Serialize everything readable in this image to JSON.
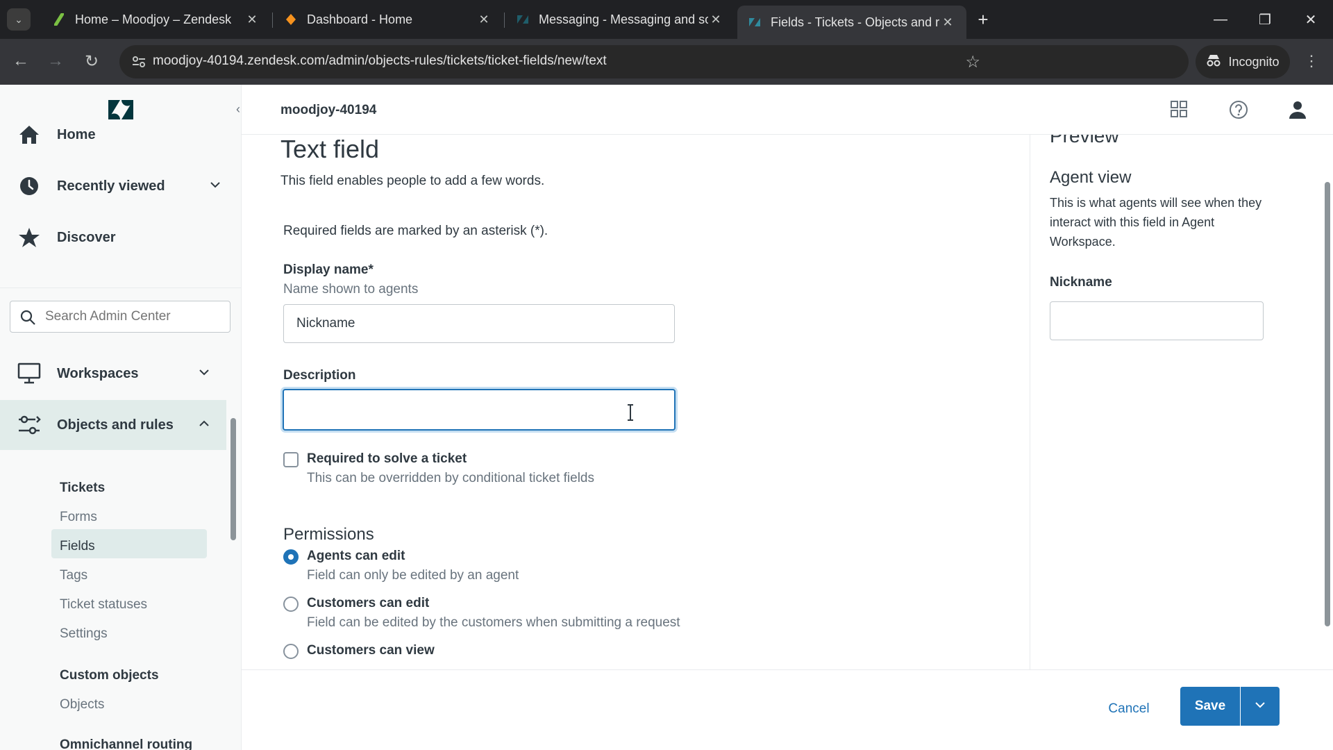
{
  "browser": {
    "tabs": [
      {
        "title": "Home – Moodjoy – Zendesk",
        "favicon": "zendesk-green-leaf-icon"
      },
      {
        "title": "Dashboard - Home",
        "favicon": "orange-diamond-icon"
      },
      {
        "title": "Messaging - Messaging and so",
        "favicon": "zendesk-icon"
      },
      {
        "title": "Fields - Tickets - Objects and ru",
        "favicon": "zendesk-icon",
        "active": true
      }
    ],
    "url": "moodjoy-40194.zendesk.com/admin/objects-rules/tickets/ticket-fields/new/text",
    "incognito_label": "Incognito"
  },
  "sidebar": {
    "nav": [
      {
        "label": "Home",
        "icon": "home-icon"
      },
      {
        "label": "Recently viewed",
        "icon": "clock-icon"
      },
      {
        "label": "Discover",
        "icon": "star-icon"
      }
    ],
    "search_placeholder": "Search Admin Center",
    "sections": [
      {
        "label": "Workspaces",
        "icon": "monitor-icon"
      },
      {
        "label": "Objects and rules",
        "icon": "objects-rules-icon"
      }
    ],
    "tickets_heading": "Tickets",
    "ticket_items": [
      "Forms",
      "Fields",
      "Tags",
      "Ticket statuses",
      "Settings"
    ],
    "custom_objects_heading": "Custom objects",
    "custom_items": [
      "Objects"
    ],
    "cut_heading": "Omnichannel routing"
  },
  "header": {
    "account": "moodjoy-40194"
  },
  "form": {
    "title": "Text field",
    "subtitle": "This field enables people to add a few words.",
    "required_note": "Required fields are marked by an asterisk (*).",
    "display_name_label": "Display name*",
    "display_name_hint": "Name shown to agents",
    "display_name_value": "Nickname",
    "description_label": "Description",
    "description_value": "",
    "required_label": "Required to solve a ticket",
    "required_hint": "This can be overridden by conditional ticket fields",
    "permissions_heading": "Permissions",
    "permissions": [
      {
        "label": "Agents can edit",
        "hint": "Field can only be edited by an agent",
        "selected": true
      },
      {
        "label": "Customers can edit",
        "hint": "Field can be edited by the customers when submitting a request",
        "selected": false
      },
      {
        "label": "Customers can view",
        "hint": "",
        "selected": false
      }
    ]
  },
  "preview": {
    "title": "Preview",
    "agent_heading": "Agent view",
    "agent_text": "This is what agents will see when they interact with this field in Agent Workspace.",
    "field_label": "Nickname"
  },
  "footer": {
    "cancel_label": "Cancel",
    "save_label": "Save"
  },
  "colors": {
    "accent": "#1f73b7",
    "sidebar_active": "#e1ecea"
  }
}
